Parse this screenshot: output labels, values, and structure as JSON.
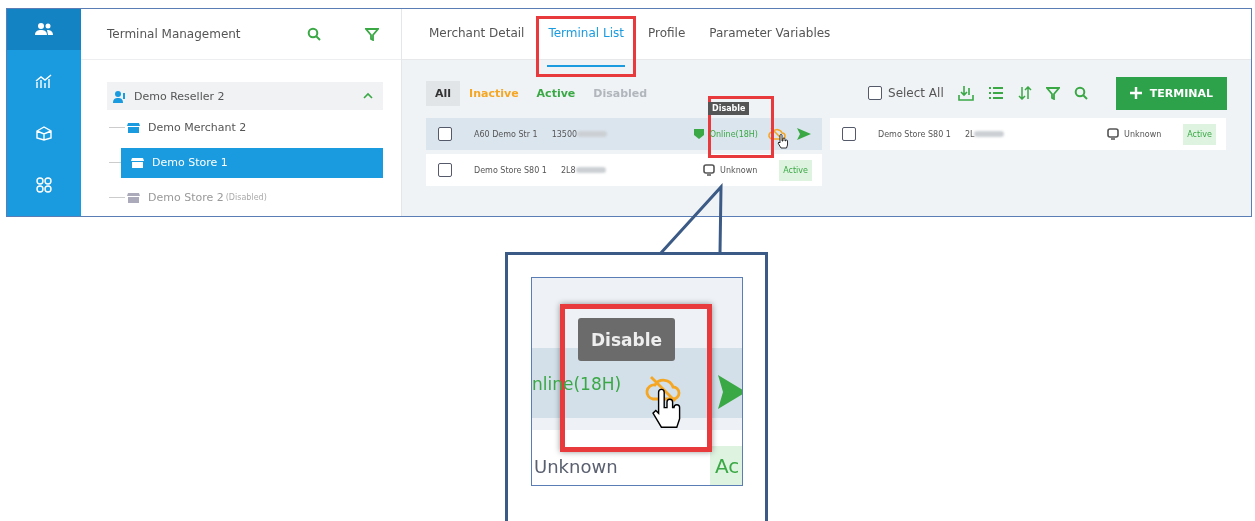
{
  "rail": {
    "items": [
      {
        "kind": "users",
        "selected": true
      },
      {
        "kind": "chart",
        "selected": false
      },
      {
        "kind": "package",
        "selected": false
      },
      {
        "kind": "apps",
        "selected": false
      }
    ]
  },
  "tree_panel": {
    "title": "Terminal Management",
    "tree": {
      "label": "Demo Reseller 2",
      "expanded": true,
      "children": [
        {
          "label": "Demo Merchant 2",
          "selected": false,
          "disabled": false
        },
        {
          "label": "Demo Store 1",
          "selected": true,
          "disabled": false
        },
        {
          "label": "Demo Store 2",
          "selected": false,
          "disabled": true,
          "note": "(Disabled)"
        }
      ]
    }
  },
  "tabs": [
    {
      "label": "Merchant Detail",
      "selected": false,
      "annotated": false
    },
    {
      "label": "Terminal List",
      "selected": true,
      "annotated": true
    },
    {
      "label": "Profile",
      "selected": false,
      "annotated": false
    },
    {
      "label": "Parameter Variables",
      "selected": false,
      "annotated": false
    }
  ],
  "filters": [
    {
      "label": "All",
      "selected": true,
      "color": "#333333"
    },
    {
      "label": "Inactive",
      "selected": false,
      "color": "#f5a623"
    },
    {
      "label": "Active",
      "selected": false,
      "color": "#3aa845"
    },
    {
      "label": "Disabled",
      "selected": false,
      "color": "#b0b6bc"
    }
  ],
  "toolbar": {
    "select_all": "Select All",
    "select_all_checked": false,
    "button": "TERMINAL"
  },
  "terminal_columns": [
    {
      "rows": [
        {
          "name": "A60 Demo Str 1",
          "serial": "13500",
          "checked": false,
          "kind": "online",
          "status": "Online(18H)",
          "highlighted": true,
          "tooltip": "Disable",
          "badge": null
        },
        {
          "name": "Demo Store S80 1",
          "serial": "2L8",
          "checked": false,
          "kind": "unknown",
          "status": "Unknown",
          "highlighted": false,
          "tooltip": null,
          "badge": "Active"
        }
      ]
    },
    {
      "rows": [
        {
          "name": "Demo Store S80 1",
          "serial": "2L",
          "checked": false,
          "kind": "unknown",
          "status": "Unknown",
          "highlighted": false,
          "tooltip": null,
          "badge": "Active"
        }
      ]
    }
  ],
  "callout": {
    "tooltip": "Disable",
    "status": "nline(18H)",
    "next_status": "Unknown",
    "next_badge": "Ac"
  }
}
